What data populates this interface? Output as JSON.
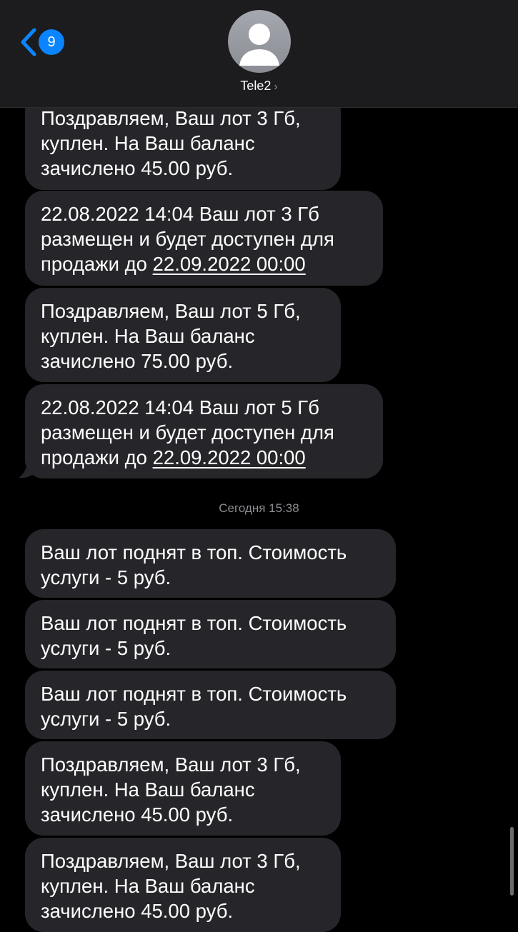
{
  "header": {
    "unread_count": "9",
    "contact_name": "Tele2",
    "contact_chevron": "›"
  },
  "messages": [
    {
      "text": "Поздравляем, Ваш лот 3 Гб,\nкуплен. На Ваш баланс\nзачислено 45.00 руб."
    },
    {
      "text_before": "22.08.2022 14:04 Ваш лот 3 Гб\nразмещен и будет доступен для\nпродажи до ",
      "link": "22.09.2022 00:00"
    },
    {
      "text": "Поздравляем, Ваш лот 5 Гб,\nкуплен. На Ваш баланс\nзачислено 75.00 руб."
    },
    {
      "text_before": "22.08.2022 14:04 Ваш лот 5 Гб\nразмещен и будет доступен для\nпродажи до ",
      "link": "22.09.2022 00:00"
    },
    {
      "text": "Ваш лот поднят в топ.  Стоимость\nуслуги - 5 руб."
    },
    {
      "text": "Ваш лот поднят в топ.  Стоимость\nуслуги - 5 руб."
    },
    {
      "text": "Ваш лот поднят в топ.  Стоимость\nуслуги - 5 руб."
    },
    {
      "text": "Поздравляем, Ваш лот 3 Гб,\nкуплен. На Ваш баланс\nзачислено 45.00 руб."
    },
    {
      "text": "Поздравляем, Ваш лот 3 Гб,\nкуплен. На Ваш баланс\nзачислено 45.00 руб."
    }
  ],
  "timestamp": "Сегодня 15:38",
  "colors": {
    "background": "#000000",
    "header": "#1c1c1e",
    "bubble": "#26252a",
    "accent": "#0a84ff",
    "secondary_text": "#8e8e93"
  },
  "icons": {
    "back": "chevron-left-icon",
    "avatar": "person-silhouette-icon"
  }
}
